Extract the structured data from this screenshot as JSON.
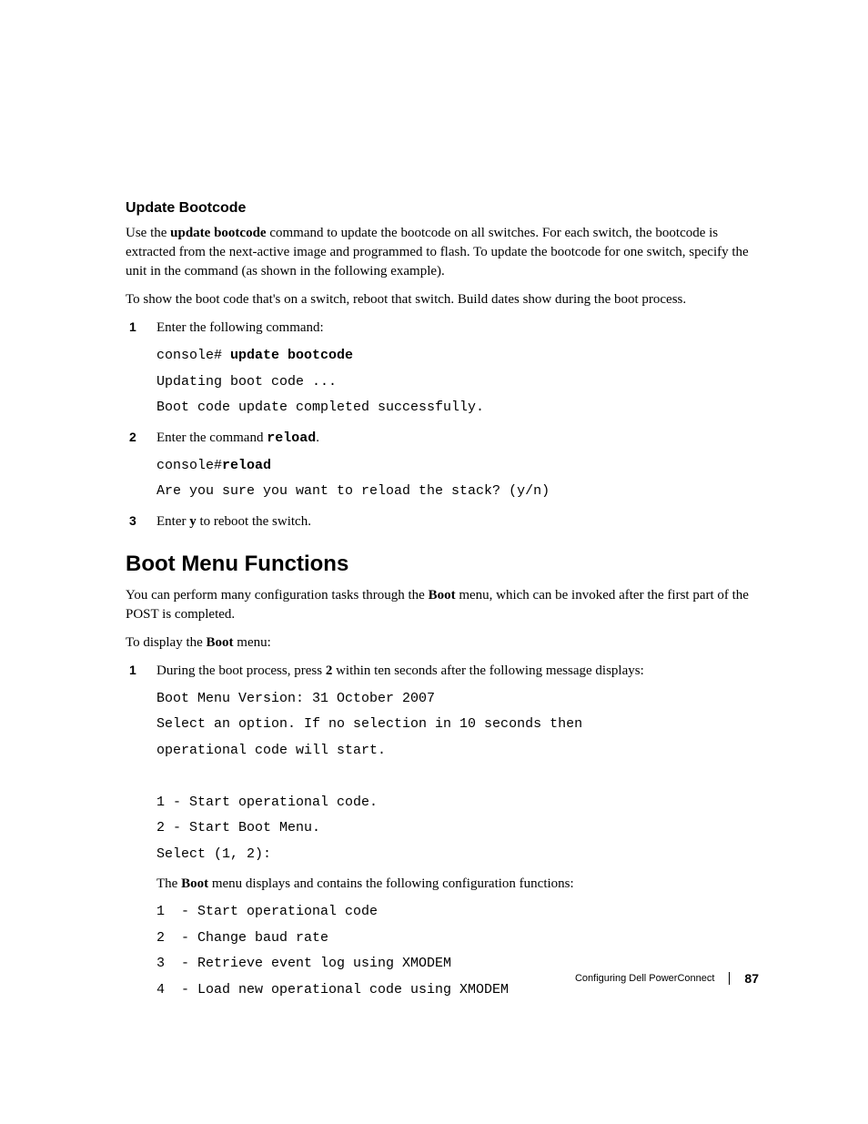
{
  "subhead": "Update Bootcode",
  "intro_pre": "Use the ",
  "intro_bold": "update bootcode",
  "intro_post": " command to update the bootcode on all switches. For each switch, the bootcode is extracted from the next-active image and programmed to flash. To update the bootcode for one switch, specify the unit in the command (as shown in the following example).",
  "intro2": "To show the boot code that's on a switch, reboot that switch. Build dates show during the boot process.",
  "steps1": {
    "s1_text": "Enter the following command:",
    "s1_console_pre": "console# ",
    "s1_console_bold": "update bootcode",
    "s1_line2": "Updating boot code ...",
    "s1_line3": "Boot code update completed successfully.",
    "s2_pre": "Enter the command ",
    "s2_bold": "reload",
    "s2_post": ".",
    "s2_console_pre": "console#",
    "s2_console_bold": "reload",
    "s2_line2": "Are you sure you want to reload the stack? (y/n)",
    "s3_pre": "Enter ",
    "s3_bold": "y",
    "s3_post": " to reboot the switch."
  },
  "section2": "Boot Menu Functions",
  "sec2_p1_pre": "You can perform many configuration tasks through the ",
  "sec2_p1_bold": "Boot",
  "sec2_p1_post": " menu, which can be invoked after the first part of the POST is completed.",
  "sec2_p2_pre": "To display the ",
  "sec2_p2_bold": "Boot",
  "sec2_p2_post": " menu:",
  "steps2": {
    "s1_pre": "During the boot process, press ",
    "s1_bold": "2",
    "s1_post": " within ten seconds after the following message displays:",
    "code1_l1": "Boot Menu Version: 31 October 2007",
    "code1_l2": "Select an option. If no selection in 10 seconds then",
    "code1_l3": "operational code will start.",
    "code1_l4": "",
    "code1_l5": "1 - Start operational code.",
    "code1_l6": "2 - Start Boot Menu.",
    "code1_l7": "Select (1, 2):",
    "mid_pre": "The ",
    "mid_bold": "Boot",
    "mid_post": " menu displays and contains the following configuration functions:",
    "code2_l1": "1  - Start operational code",
    "code2_l2": "2  - Change baud rate",
    "code2_l3": "3  - Retrieve event log using XMODEM",
    "code2_l4": "4  - Load new operational code using XMODEM"
  },
  "footer_title": "Configuring Dell PowerConnect",
  "footer_page": "87"
}
